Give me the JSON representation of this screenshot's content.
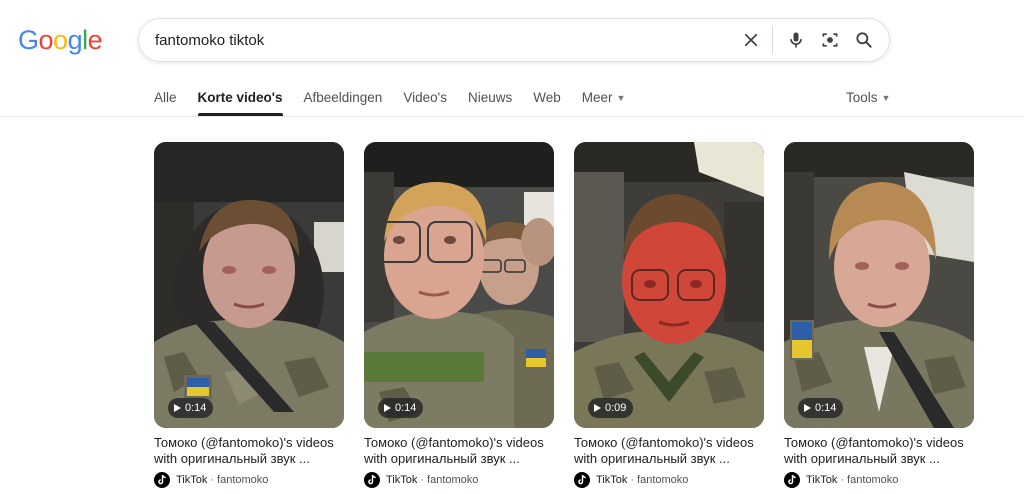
{
  "logo": {
    "letters": [
      {
        "char": "G",
        "color": "#4285F4"
      },
      {
        "char": "o",
        "color": "#EA4335"
      },
      {
        "char": "o",
        "color": "#FBBC05"
      },
      {
        "char": "g",
        "color": "#4285F4"
      },
      {
        "char": "l",
        "color": "#34A853"
      },
      {
        "char": "e",
        "color": "#EA4335"
      }
    ]
  },
  "search": {
    "query": "fantomoko tiktok",
    "icons": [
      "close-icon",
      "microphone-icon",
      "camera-lens-icon",
      "search-icon"
    ]
  },
  "tabs": [
    {
      "label": "Alle",
      "active": false
    },
    {
      "label": "Korte video's",
      "active": true
    },
    {
      "label": "Afbeeldingen",
      "active": false
    },
    {
      "label": "Video's",
      "active": false
    },
    {
      "label": "Nieuws",
      "active": false
    },
    {
      "label": "Web",
      "active": false
    },
    {
      "label": "Meer",
      "active": false,
      "dropdown": true
    }
  ],
  "tools": {
    "label": "Tools"
  },
  "videos": [
    {
      "duration": "0:14",
      "title_line1": "Томоко (@fantomoko)'s videos",
      "title_line2": "with оригинальный звук ...",
      "platform": "TikTok",
      "channel": "fantomoko",
      "icon": "tiktok-icon"
    },
    {
      "duration": "0:14",
      "title_line1": "Томоко (@fantomoko)'s videos",
      "title_line2": "with оригинальный звук ...",
      "platform": "TikTok",
      "channel": "fantomoko",
      "icon": "tiktok-icon"
    },
    {
      "duration": "0:09",
      "title_line1": "Томоко (@fantomoko)'s videos",
      "title_line2": "with оригинальный звук ...",
      "platform": "TikTok",
      "channel": "fantomoko",
      "icon": "tiktok-icon"
    },
    {
      "duration": "0:14",
      "title_line1": "Томоко (@fantomoko)'s videos",
      "title_line2": "with оригинальный звук ...",
      "platform": "TikTok",
      "channel": "fantomoko",
      "icon": "tiktok-icon"
    }
  ],
  "colors": {
    "accent_text": "#202124",
    "muted_text": "#4d5156",
    "divider": "#ebebeb"
  }
}
